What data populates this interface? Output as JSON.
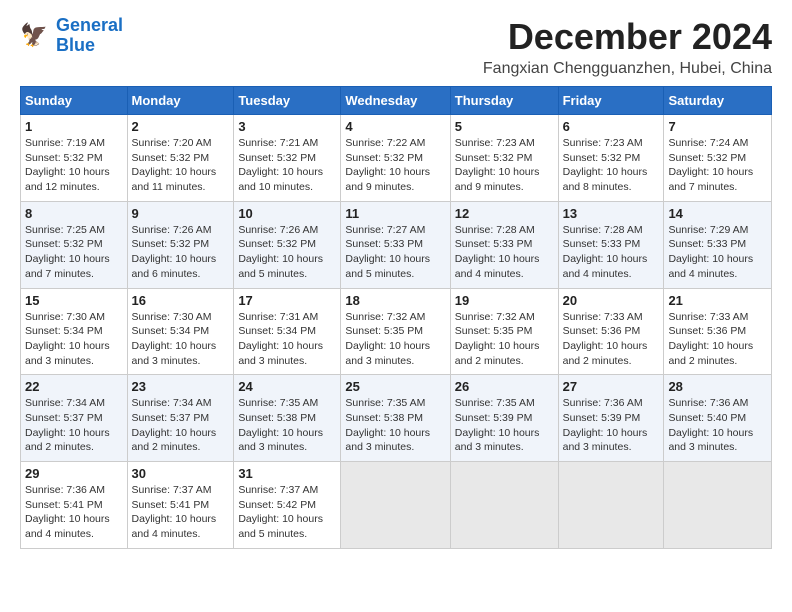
{
  "header": {
    "logo_line1": "General",
    "logo_line2": "Blue",
    "month": "December 2024",
    "location": "Fangxian Chengguanzhen, Hubei, China"
  },
  "weekdays": [
    "Sunday",
    "Monday",
    "Tuesday",
    "Wednesday",
    "Thursday",
    "Friday",
    "Saturday"
  ],
  "weeks": [
    [
      {
        "day": "1",
        "text": "Sunrise: 7:19 AM\nSunset: 5:32 PM\nDaylight: 10 hours\nand 12 minutes."
      },
      {
        "day": "2",
        "text": "Sunrise: 7:20 AM\nSunset: 5:32 PM\nDaylight: 10 hours\nand 11 minutes."
      },
      {
        "day": "3",
        "text": "Sunrise: 7:21 AM\nSunset: 5:32 PM\nDaylight: 10 hours\nand 10 minutes."
      },
      {
        "day": "4",
        "text": "Sunrise: 7:22 AM\nSunset: 5:32 PM\nDaylight: 10 hours\nand 9 minutes."
      },
      {
        "day": "5",
        "text": "Sunrise: 7:23 AM\nSunset: 5:32 PM\nDaylight: 10 hours\nand 9 minutes."
      },
      {
        "day": "6",
        "text": "Sunrise: 7:23 AM\nSunset: 5:32 PM\nDaylight: 10 hours\nand 8 minutes."
      },
      {
        "day": "7",
        "text": "Sunrise: 7:24 AM\nSunset: 5:32 PM\nDaylight: 10 hours\nand 7 minutes."
      }
    ],
    [
      {
        "day": "8",
        "text": "Sunrise: 7:25 AM\nSunset: 5:32 PM\nDaylight: 10 hours\nand 7 minutes."
      },
      {
        "day": "9",
        "text": "Sunrise: 7:26 AM\nSunset: 5:32 PM\nDaylight: 10 hours\nand 6 minutes."
      },
      {
        "day": "10",
        "text": "Sunrise: 7:26 AM\nSunset: 5:32 PM\nDaylight: 10 hours\nand 5 minutes."
      },
      {
        "day": "11",
        "text": "Sunrise: 7:27 AM\nSunset: 5:33 PM\nDaylight: 10 hours\nand 5 minutes."
      },
      {
        "day": "12",
        "text": "Sunrise: 7:28 AM\nSunset: 5:33 PM\nDaylight: 10 hours\nand 4 minutes."
      },
      {
        "day": "13",
        "text": "Sunrise: 7:28 AM\nSunset: 5:33 PM\nDaylight: 10 hours\nand 4 minutes."
      },
      {
        "day": "14",
        "text": "Sunrise: 7:29 AM\nSunset: 5:33 PM\nDaylight: 10 hours\nand 4 minutes."
      }
    ],
    [
      {
        "day": "15",
        "text": "Sunrise: 7:30 AM\nSunset: 5:34 PM\nDaylight: 10 hours\nand 3 minutes."
      },
      {
        "day": "16",
        "text": "Sunrise: 7:30 AM\nSunset: 5:34 PM\nDaylight: 10 hours\nand 3 minutes."
      },
      {
        "day": "17",
        "text": "Sunrise: 7:31 AM\nSunset: 5:34 PM\nDaylight: 10 hours\nand 3 minutes."
      },
      {
        "day": "18",
        "text": "Sunrise: 7:32 AM\nSunset: 5:35 PM\nDaylight: 10 hours\nand 3 minutes."
      },
      {
        "day": "19",
        "text": "Sunrise: 7:32 AM\nSunset: 5:35 PM\nDaylight: 10 hours\nand 2 minutes."
      },
      {
        "day": "20",
        "text": "Sunrise: 7:33 AM\nSunset: 5:36 PM\nDaylight: 10 hours\nand 2 minutes."
      },
      {
        "day": "21",
        "text": "Sunrise: 7:33 AM\nSunset: 5:36 PM\nDaylight: 10 hours\nand 2 minutes."
      }
    ],
    [
      {
        "day": "22",
        "text": "Sunrise: 7:34 AM\nSunset: 5:37 PM\nDaylight: 10 hours\nand 2 minutes."
      },
      {
        "day": "23",
        "text": "Sunrise: 7:34 AM\nSunset: 5:37 PM\nDaylight: 10 hours\nand 2 minutes."
      },
      {
        "day": "24",
        "text": "Sunrise: 7:35 AM\nSunset: 5:38 PM\nDaylight: 10 hours\nand 3 minutes."
      },
      {
        "day": "25",
        "text": "Sunrise: 7:35 AM\nSunset: 5:38 PM\nDaylight: 10 hours\nand 3 minutes."
      },
      {
        "day": "26",
        "text": "Sunrise: 7:35 AM\nSunset: 5:39 PM\nDaylight: 10 hours\nand 3 minutes."
      },
      {
        "day": "27",
        "text": "Sunrise: 7:36 AM\nSunset: 5:39 PM\nDaylight: 10 hours\nand 3 minutes."
      },
      {
        "day": "28",
        "text": "Sunrise: 7:36 AM\nSunset: 5:40 PM\nDaylight: 10 hours\nand 3 minutes."
      }
    ],
    [
      {
        "day": "29",
        "text": "Sunrise: 7:36 AM\nSunset: 5:41 PM\nDaylight: 10 hours\nand 4 minutes."
      },
      {
        "day": "30",
        "text": "Sunrise: 7:37 AM\nSunset: 5:41 PM\nDaylight: 10 hours\nand 4 minutes."
      },
      {
        "day": "31",
        "text": "Sunrise: 7:37 AM\nSunset: 5:42 PM\nDaylight: 10 hours\nand 5 minutes."
      },
      {
        "day": "",
        "text": ""
      },
      {
        "day": "",
        "text": ""
      },
      {
        "day": "",
        "text": ""
      },
      {
        "day": "",
        "text": ""
      }
    ]
  ]
}
